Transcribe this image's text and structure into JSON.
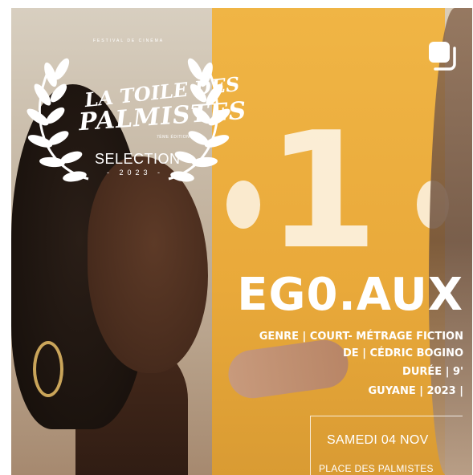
{
  "poster": {
    "festival_small": "FESTIVAL DE CINÉMA",
    "logo_line1": "LA TOILE DES",
    "logo_line2": "PALMISTES",
    "edition": "7ÈME ÉDITION",
    "selection_label": "SELECTION",
    "selection_year": "- 2023 -",
    "wall_number": "1",
    "title": "EG0.AUX",
    "meta_lines": [
      "GENRE | COURT- MÉTRAGE FICTION",
      "DE | CÉDRIC BOGINO",
      "DURÉE | 9'",
      "GUYANE | 2023 |"
    ],
    "date": "SAMEDI 04 NOV",
    "place": "PLACE DES PALMISTES"
  },
  "icons": {
    "corner": "copy-multiple-icon",
    "laurel": "laurel-wreath-icon"
  },
  "colors": {
    "yellow_wall": "#e9a93a",
    "text": "#ffffff"
  }
}
